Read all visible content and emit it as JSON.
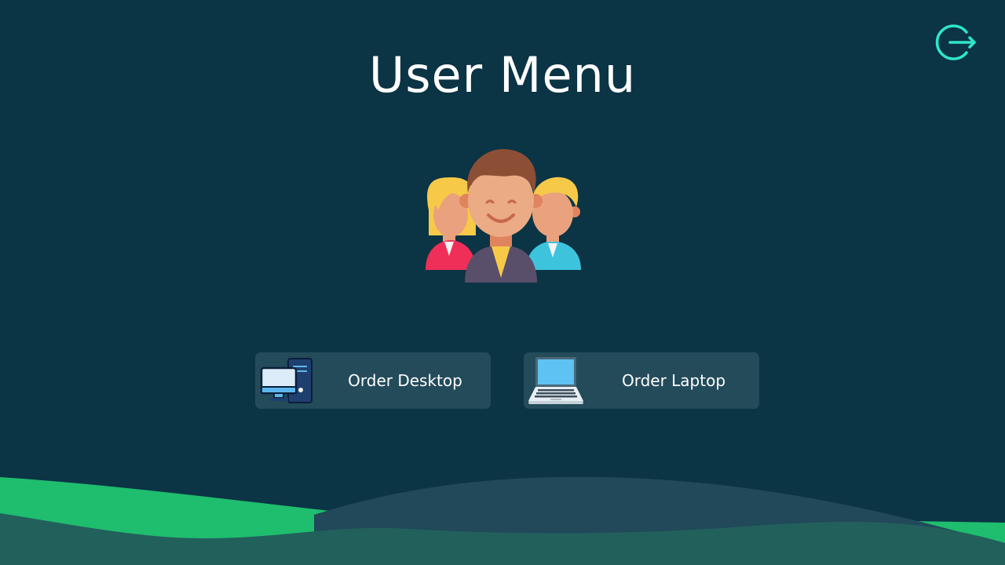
{
  "header": {
    "title": "User Menu",
    "logout_icon": "logout-icon"
  },
  "hero": {
    "icon": "user-group-illustration"
  },
  "actions": {
    "desktop": {
      "label": "Order Desktop",
      "icon": "desktop-computer-icon"
    },
    "laptop": {
      "label": "Order Laptop",
      "icon": "laptop-icon"
    }
  },
  "colors": {
    "background": "#0b3445",
    "button_bg": "#234b5a",
    "accent": "#2ee6c8",
    "wave_green": "#1fbd6e",
    "wave_dark": "#22605c"
  }
}
